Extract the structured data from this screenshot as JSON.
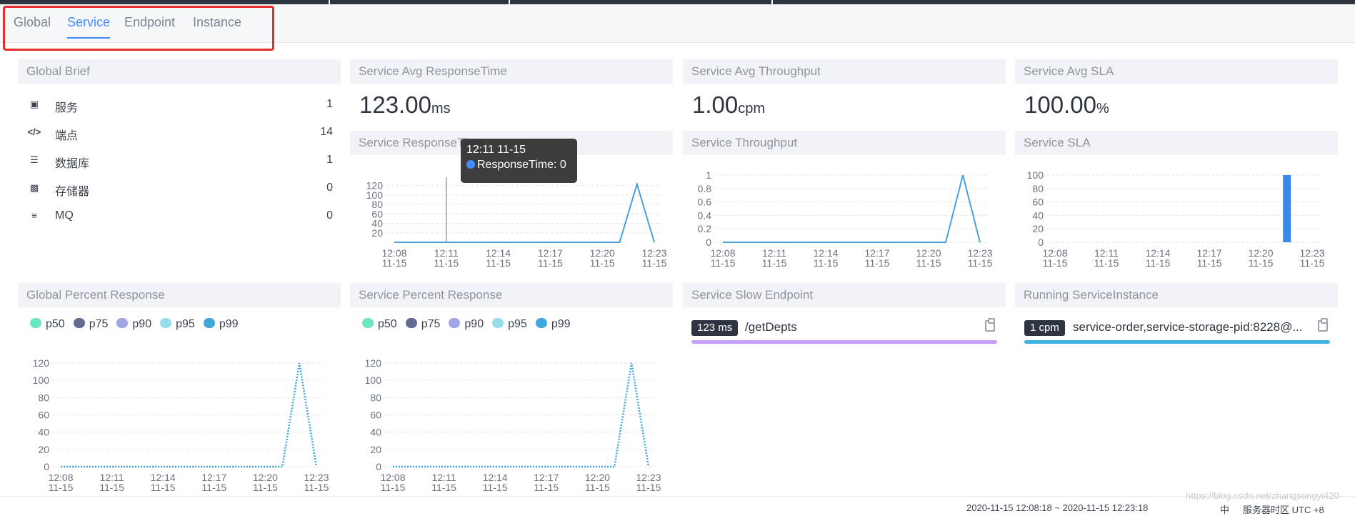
{
  "tabs": [
    {
      "label": "Global",
      "active": false
    },
    {
      "label": "Service",
      "active": true
    },
    {
      "label": "Endpoint",
      "active": false
    },
    {
      "label": "Instance",
      "active": false
    }
  ],
  "panels": {
    "global_brief": "Global Brief",
    "avg_response_time": "Service Avg ResponseTime",
    "avg_throughput": "Service Avg Throughput",
    "avg_sla": "Service Avg SLA",
    "response_time": "Service ResponseTime",
    "throughput": "Service Throughput",
    "sla": "Service SLA",
    "global_percent": "Global Percent Response",
    "service_percent": "Service Percent Response",
    "slow_endpoint": "Service Slow Endpoint",
    "running_instance": "Running ServiceInstance"
  },
  "stats": {
    "response_value": "123.00",
    "response_unit": "ms",
    "throughput_value": "1.00",
    "throughput_unit": "cpm",
    "sla_value": "100.00",
    "sla_unit": "%"
  },
  "global_brief": [
    {
      "icon": "briefcase-icon",
      "label": "服务",
      "count": "1"
    },
    {
      "icon": "code-icon",
      "label": "端点",
      "count": "14"
    },
    {
      "icon": "database-icon",
      "label": "数据库",
      "count": "1"
    },
    {
      "icon": "storage-icon",
      "label": "存储器",
      "count": "0"
    },
    {
      "icon": "mq-icon",
      "label": "MQ",
      "count": "0"
    }
  ],
  "tooltip": {
    "title": "12:11 11-15",
    "series": "ResponseTime: 0"
  },
  "legend": [
    {
      "name": "p50",
      "color": "#6be6c1"
    },
    {
      "name": "p75",
      "color": "#626c91"
    },
    {
      "name": "p90",
      "color": "#a0a7e6"
    },
    {
      "name": "p95",
      "color": "#96dee8"
    },
    {
      "name": "p99",
      "color": "#3fa7dc"
    }
  ],
  "slow_endpoint": {
    "badge": "123 ms",
    "name": "/getDepts",
    "bar_color": "#c59ff6"
  },
  "running_instance": {
    "badge": "1 cpm",
    "name": "service-order,service-storage-pid:8228@...",
    "bar_color": "#3fb1e3"
  },
  "footer": {
    "time_range": "2020-11-15 12:08:18 ~ 2020-11-15 12:23:18",
    "lang": "中",
    "timezone": "服务器时区 UTC +8"
  },
  "watermark": "https://blog.csdn.net/zhangsongyi420",
  "chart_data": [
    {
      "type": "line",
      "title": "Service ResponseTime",
      "x": [
        "12:08\n11-15",
        "12:11\n11-15",
        "12:14\n11-15",
        "12:17\n11-15",
        "12:20\n11-15",
        "12:23\n11-15"
      ],
      "yticks": [
        20,
        40,
        60,
        80,
        100,
        120
      ],
      "ylim": [
        0,
        130
      ],
      "series": [
        {
          "points": [
            [
              0,
              0
            ],
            [
              13,
              0
            ],
            [
              14,
              123
            ],
            [
              15,
              0
            ]
          ]
        }
      ]
    },
    {
      "type": "line",
      "title": "Service Throughput",
      "x": [
        "12:08\n11-15",
        "12:11\n11-15",
        "12:14\n11-15",
        "12:17\n11-15",
        "12:20\n11-15",
        "12:23\n11-15"
      ],
      "yticks": [
        0,
        0.2,
        0.4,
        0.6,
        0.8,
        1
      ],
      "ylim": [
        0,
        1
      ],
      "series": [
        {
          "points": [
            [
              0,
              0
            ],
            [
              13,
              0
            ],
            [
              14,
              1
            ],
            [
              15,
              0
            ]
          ]
        }
      ]
    },
    {
      "type": "bar",
      "title": "Service SLA",
      "x": [
        "12:08\n11-15",
        "12:11\n11-15",
        "12:14\n11-15",
        "12:17\n11-15",
        "12:20\n11-15",
        "12:23\n11-15"
      ],
      "yticks": [
        0,
        20,
        40,
        60,
        80,
        100
      ],
      "ylim": [
        0,
        100
      ],
      "series": [
        {
          "points": [
            [
              14,
              100
            ]
          ]
        }
      ]
    },
    {
      "type": "line",
      "title": "Global Percent Response",
      "x": [
        "12:08\n11-15",
        "12:11\n11-15",
        "12:14\n11-15",
        "12:17\n11-15",
        "12:20\n11-15",
        "12:23\n11-15"
      ],
      "yticks": [
        0,
        20,
        40,
        60,
        80,
        100,
        120
      ],
      "ylim": [
        0,
        120
      ],
      "series": [
        {
          "points": [
            [
              0,
              0
            ],
            [
              13,
              0
            ],
            [
              14,
              120
            ],
            [
              15,
              0
            ]
          ]
        }
      ]
    },
    {
      "type": "line",
      "title": "Service Percent Response",
      "x": [
        "12:08\n11-15",
        "12:11\n11-15",
        "12:14\n11-15",
        "12:17\n11-15",
        "12:20\n11-15",
        "12:23\n11-15"
      ],
      "yticks": [
        0,
        20,
        40,
        60,
        80,
        100,
        120
      ],
      "ylim": [
        0,
        120
      ],
      "series": [
        {
          "points": [
            [
              0,
              0
            ],
            [
              13,
              0
            ],
            [
              14,
              120
            ],
            [
              15,
              0
            ]
          ]
        }
      ]
    }
  ]
}
